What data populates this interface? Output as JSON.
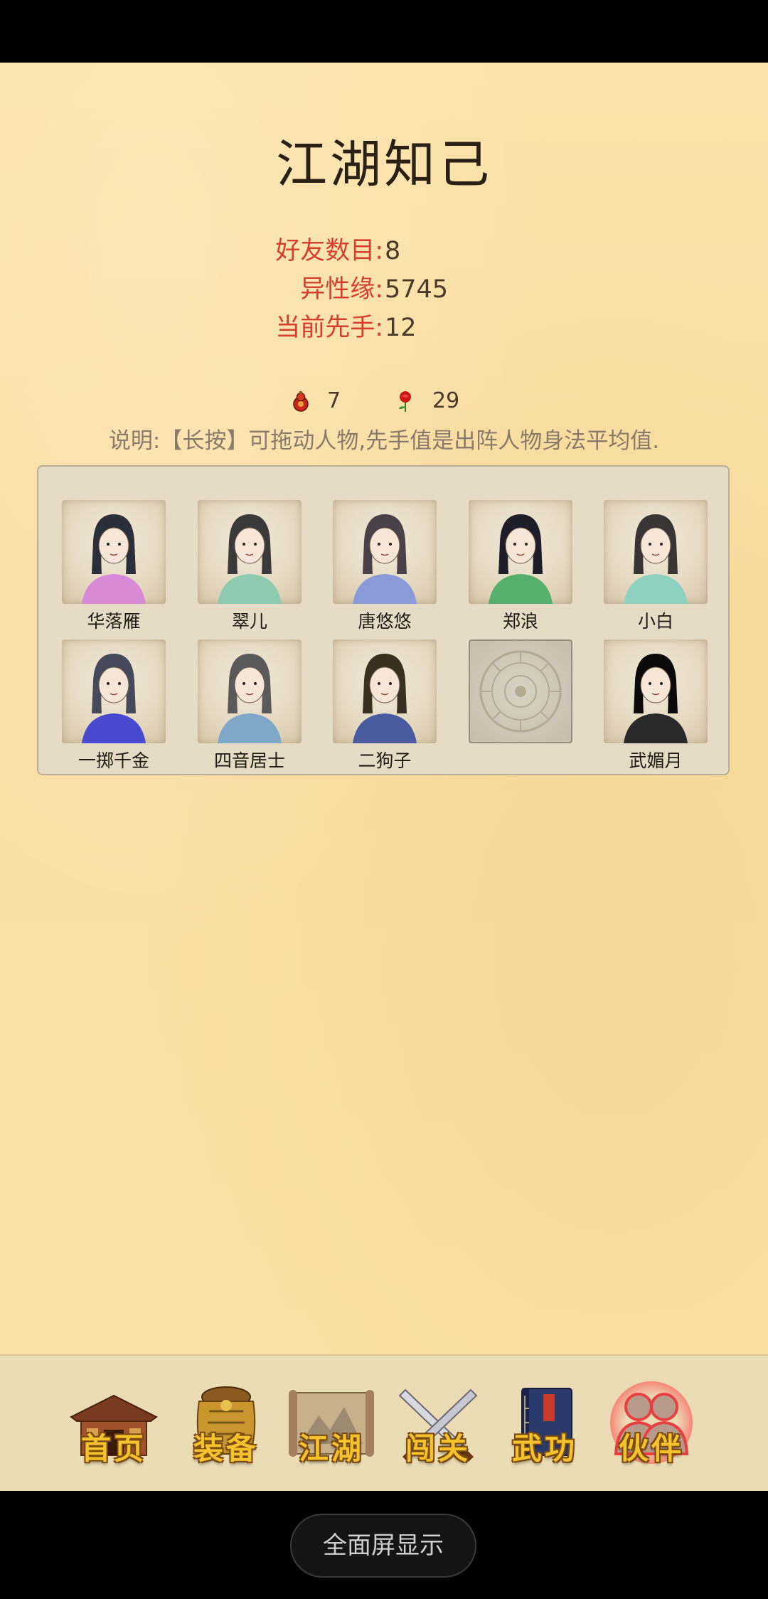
{
  "page": {
    "title": "江湖知己"
  },
  "stats": [
    {
      "label": "好友数目:",
      "value": "8"
    },
    {
      "label": "异性缘:",
      "value": "5745"
    },
    {
      "label": "当前先手:",
      "value": "12"
    }
  ],
  "currency": {
    "gourd_icon": "gourd-icon",
    "gourd_count": "7",
    "rose_icon": "rose-icon",
    "rose_count": "29"
  },
  "note": "说明:【长按】可拖动人物,先手值是出阵人物身法平均值.",
  "partners": [
    {
      "name": "华落雁",
      "robe": "#d98ad6",
      "hair": "#2a2f3a"
    },
    {
      "name": "翠儿",
      "robe": "#8fcbb0",
      "hair": "#3a3a3a"
    },
    {
      "name": "唐悠悠",
      "robe": "#8a9ad8",
      "hair": "#4a4048"
    },
    {
      "name": "郑浪",
      "robe": "#54b06a",
      "hair": "#1e1e2a"
    },
    {
      "name": "小白",
      "robe": "#8fd0c0",
      "hair": "#3a3434"
    },
    {
      "name": "一掷千金",
      "robe": "#4a4ad0",
      "hair": "#444a5a"
    },
    {
      "name": "四音居士",
      "robe": "#7fa8c8",
      "hair": "#5a5a5a"
    },
    {
      "name": "二狗子",
      "robe": "#4a5aa0",
      "hair": "#3a3020"
    },
    {
      "name": "",
      "robe": "",
      "hair": "",
      "empty": true
    },
    {
      "name": "武媚月",
      "robe": "#2a2a2a",
      "hair": "#0a0a0a"
    }
  ],
  "nav": [
    {
      "label": "首页",
      "icon": "house-icon",
      "active": false
    },
    {
      "label": "装备",
      "icon": "armor-icon",
      "active": false
    },
    {
      "label": "江湖",
      "icon": "scroll-map-icon",
      "active": false
    },
    {
      "label": "闯关",
      "icon": "crossed-swords-icon",
      "active": false
    },
    {
      "label": "武功",
      "icon": "book-icon",
      "active": false
    },
    {
      "label": "伙伴",
      "icon": "partners-icon",
      "active": true
    }
  ],
  "system": {
    "fullscreen_label": "全面屏显示"
  },
  "colors": {
    "stat_label": "#d5402e",
    "parchment": "#fbe2a8",
    "nav_label": "#f4c22c"
  }
}
